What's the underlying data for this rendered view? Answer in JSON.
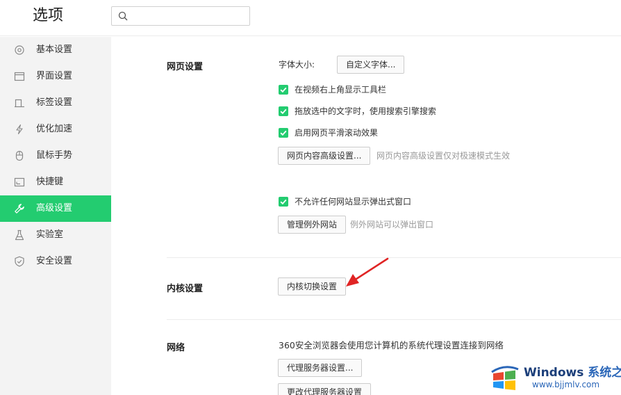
{
  "header": {
    "title": "选项",
    "search_placeholder": ""
  },
  "sidebar": {
    "items": [
      {
        "label": "基本设置",
        "icon": "target-icon"
      },
      {
        "label": "界面设置",
        "icon": "window-icon"
      },
      {
        "label": "标签设置",
        "icon": "tab-icon"
      },
      {
        "label": "优化加速",
        "icon": "lightning-icon"
      },
      {
        "label": "鼠标手势",
        "icon": "mouse-icon"
      },
      {
        "label": "快捷键",
        "icon": "keyboard-icon"
      },
      {
        "label": "高级设置",
        "icon": "wrench-icon",
        "active": true
      },
      {
        "label": "实验室",
        "icon": "flask-icon"
      },
      {
        "label": "安全设置",
        "icon": "shield-icon"
      }
    ]
  },
  "web": {
    "title": "网页设置",
    "font_size_label": "字体大小:",
    "custom_font_button": "自定义字体...",
    "checkboxes": [
      {
        "label": "在视频右上角显示工具栏",
        "checked": true
      },
      {
        "label": "拖放选中的文字时，使用搜索引擎搜索",
        "checked": true
      },
      {
        "label": "启用网页平滑滚动效果",
        "checked": true
      }
    ],
    "advanced_button": "网页内容高级设置...",
    "advanced_hint": "网页内容高级设置仅对极速模式生效",
    "popup_checkbox": {
      "label": "不允许任何网站显示弹出式窗口",
      "checked": true
    },
    "exceptions_button": "管理例外网站",
    "exceptions_hint": "例外网站可以弹出窗口"
  },
  "kernel": {
    "title": "内核设置",
    "switch_button": "内核切换设置"
  },
  "network": {
    "title": "网络",
    "description": "360安全浏览器会使用您计算机的系统代理设置连接到网络",
    "proxy_button": "代理服务器设置...",
    "change_proxy_button": "更改代理服务器设置"
  },
  "watermark": {
    "brand": "Windows",
    "brand_cn": "系统之家",
    "url": "www.bjjmlv.com"
  },
  "colors": {
    "accent": "#23cc70",
    "arrow": "#e02424",
    "sidebar_bg": "#f3f3f3"
  }
}
